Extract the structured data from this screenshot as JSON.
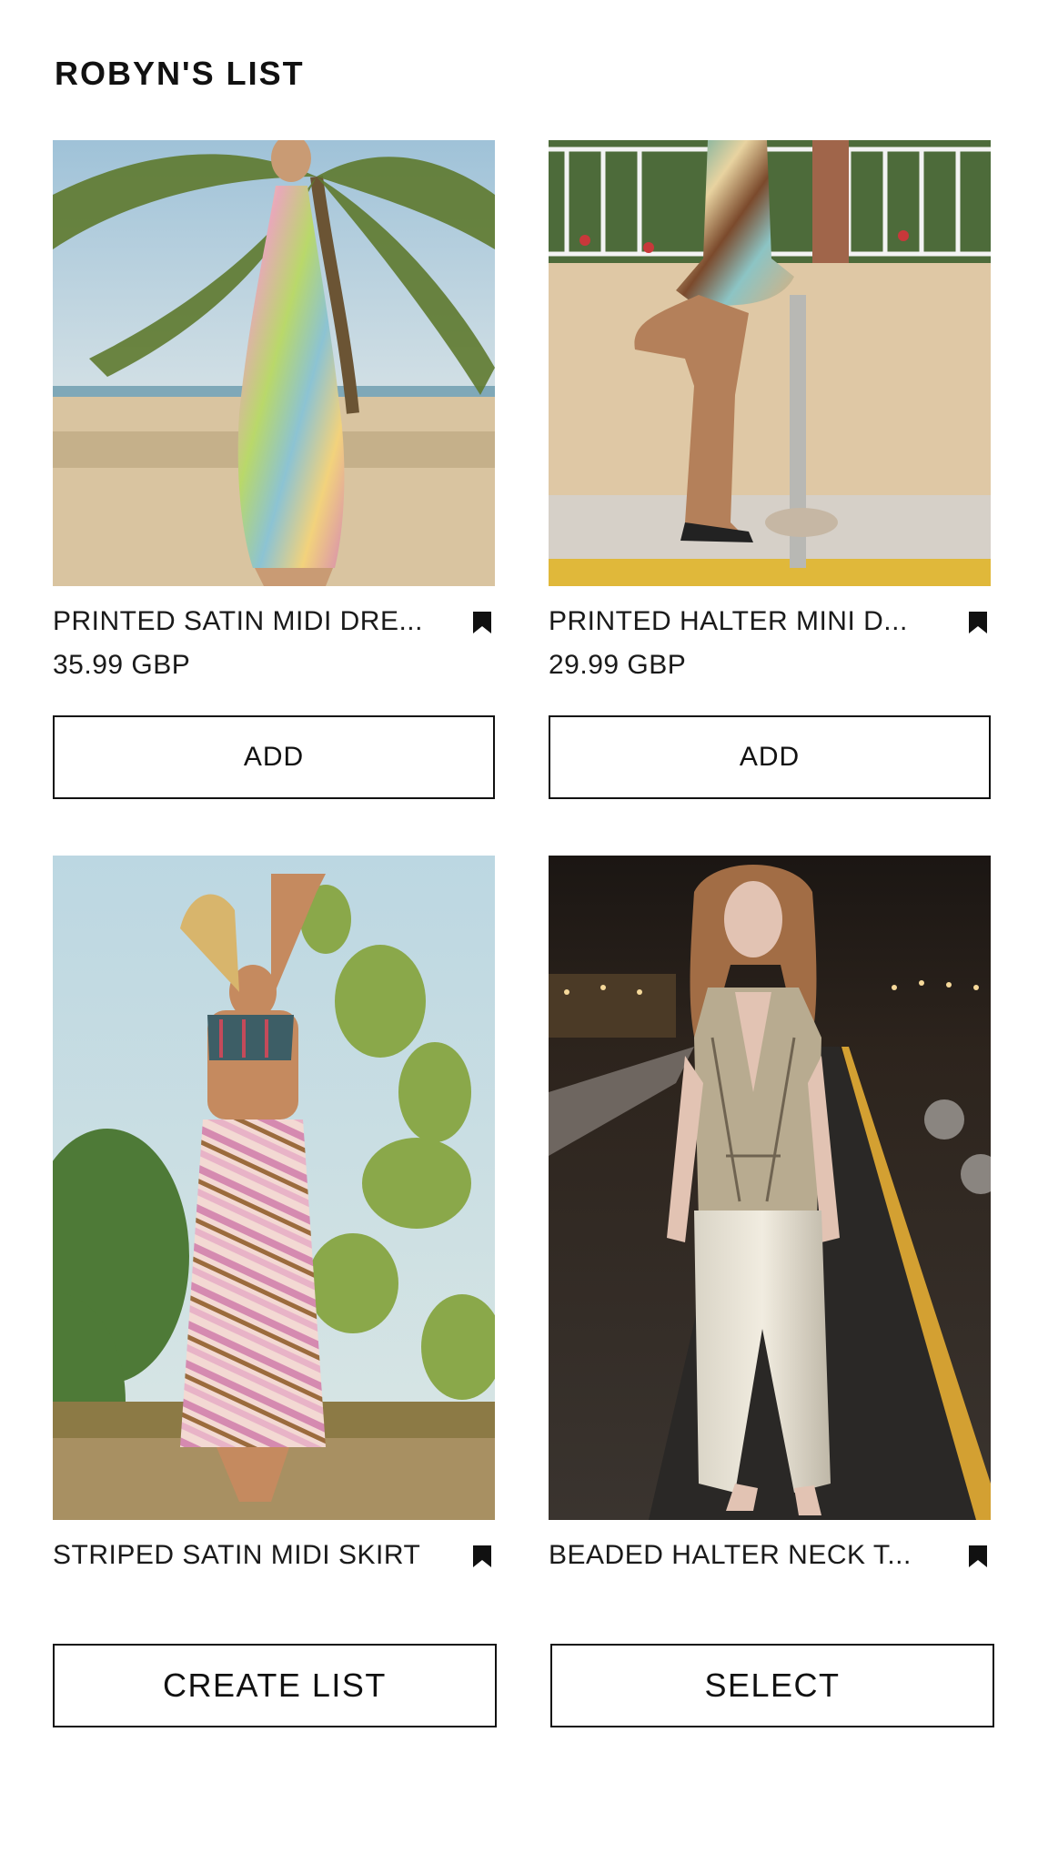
{
  "list": {
    "title": "ROBYN'S LIST"
  },
  "products": [
    {
      "name": "PRINTED SATIN MIDI DRE...",
      "price": "35.99 GBP",
      "add_label": "ADD",
      "bookmark_icon": "bookmark-filled-icon"
    },
    {
      "name": "PRINTED HALTER MINI D...",
      "price": "29.99 GBP",
      "add_label": "ADD",
      "bookmark_icon": "bookmark-filled-icon"
    },
    {
      "name": "STRIPED SATIN MIDI SKIRT",
      "bookmark_icon": "bookmark-filled-icon"
    },
    {
      "name": "BEADED HALTER NECK T...",
      "bookmark_icon": "bookmark-filled-icon"
    }
  ],
  "footer": {
    "create_list_label": "CREATE LIST",
    "select_label": "SELECT"
  },
  "colors": {
    "text": "#111111",
    "border": "#111111",
    "background": "#ffffff"
  }
}
